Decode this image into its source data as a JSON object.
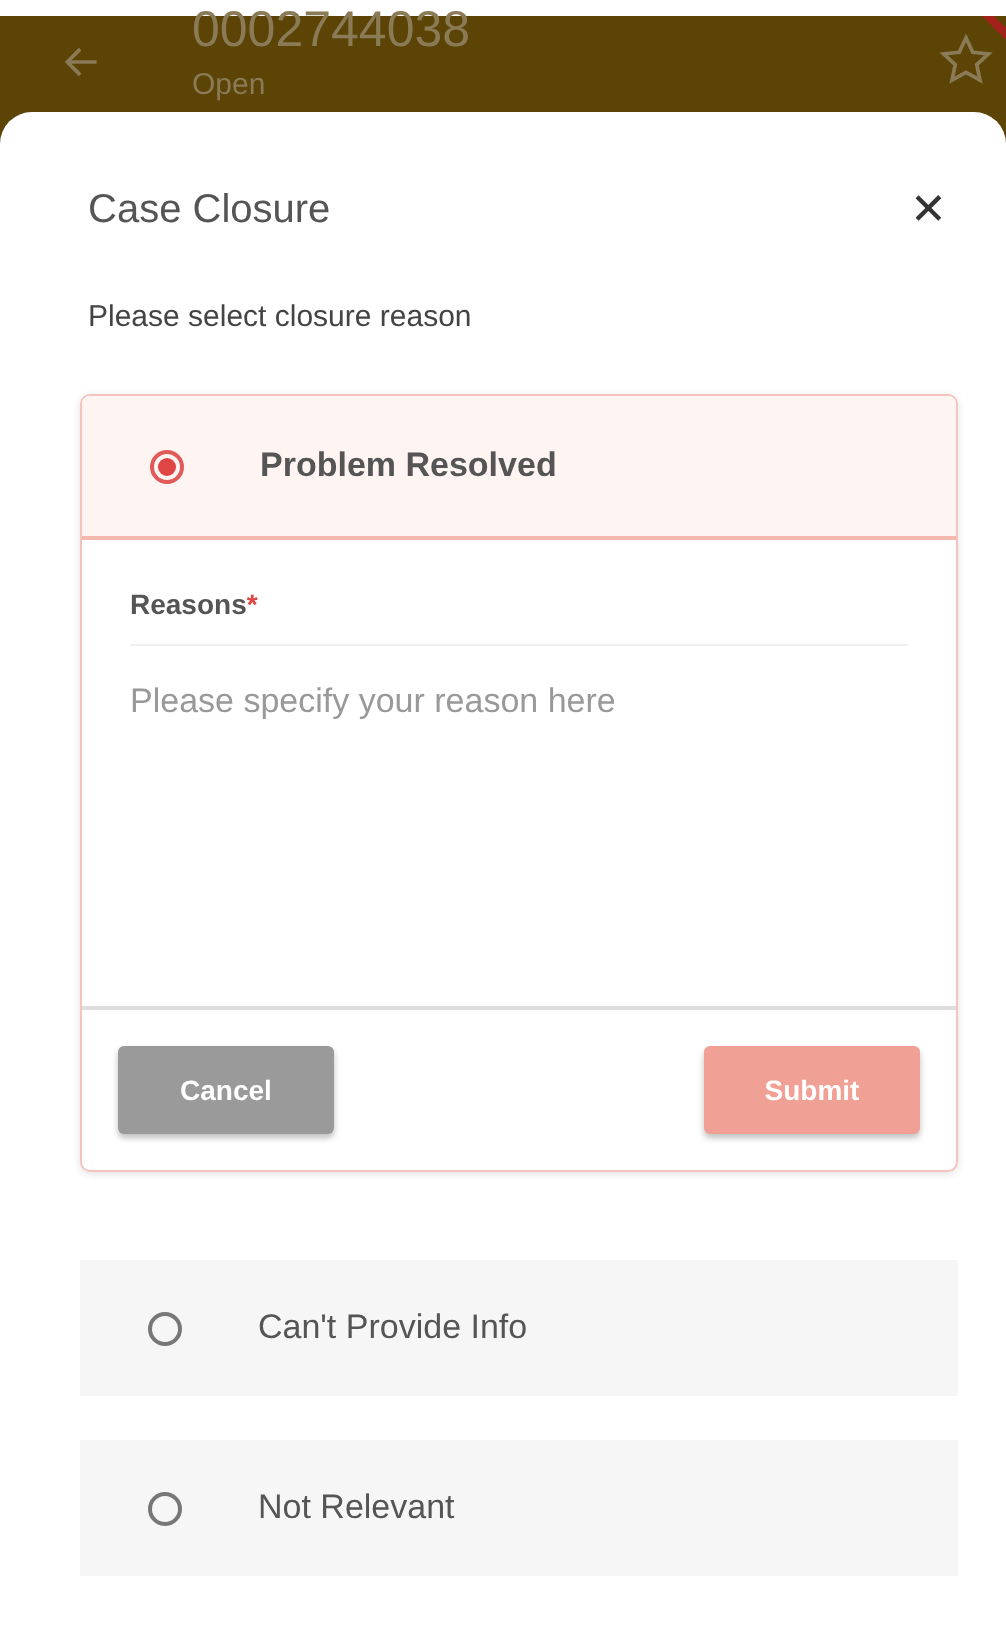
{
  "header": {
    "title": "0002744038",
    "status": "Open",
    "favorite": false
  },
  "sheet": {
    "title": "Case Closure",
    "close_icon": "✕",
    "prompt": "Please select closure reason",
    "options": [
      {
        "label": "Problem Resolved",
        "selected": true,
        "form": {
          "field_label": "Reasons",
          "required_mark": "*",
          "placeholder": "Please specify your reason here",
          "buttons": [
            {
              "label": "Cancel",
              "kind": "secondary",
              "disabled": false
            },
            {
              "label": "Submit",
              "kind": "primary",
              "disabled": true
            }
          ]
        }
      },
      {
        "label": "Can't Provide Info",
        "selected": false
      },
      {
        "label": "Not Relevant",
        "selected": false
      }
    ]
  }
}
